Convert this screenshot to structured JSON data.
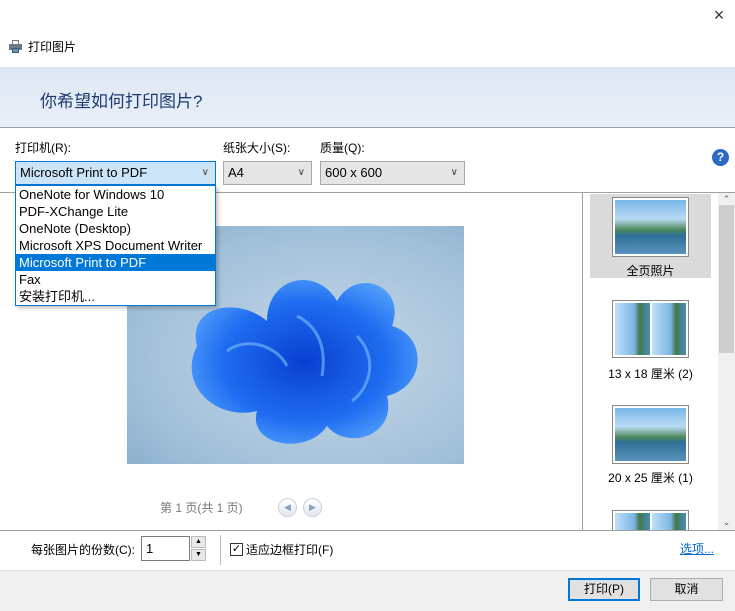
{
  "window": {
    "title": "打印图片",
    "close_icon": "×"
  },
  "header": {
    "question": "你希望如何打印图片?"
  },
  "printer": {
    "label": "打印机(R):",
    "selected": "Microsoft Print to PDF",
    "options": [
      "OneNote for Windows 10",
      "PDF-XChange Lite",
      "OneNote (Desktop)",
      "Microsoft XPS Document Writer",
      "Microsoft Print to PDF",
      "Fax",
      "安装打印机..."
    ]
  },
  "paper": {
    "label": "纸张大小(S):",
    "selected": "A4"
  },
  "quality": {
    "label": "质量(Q):",
    "selected": "600 x 600"
  },
  "help": {
    "glyph": "?"
  },
  "preview": {
    "page_text": "第 1 页(共 1 页)"
  },
  "layouts": [
    {
      "label": "全页照片",
      "selected": true
    },
    {
      "label": "13 x 18 厘米 (2)"
    },
    {
      "label": "20 x 25 厘米 (1)"
    }
  ],
  "bottom": {
    "copies_label": "每张图片的份数(C):",
    "copies_value": "1",
    "fit_label": "适应边框打印(F)",
    "fit_checked": true,
    "options_link": "选项..."
  },
  "buttons": {
    "print": "打印(P)",
    "cancel": "取消"
  }
}
